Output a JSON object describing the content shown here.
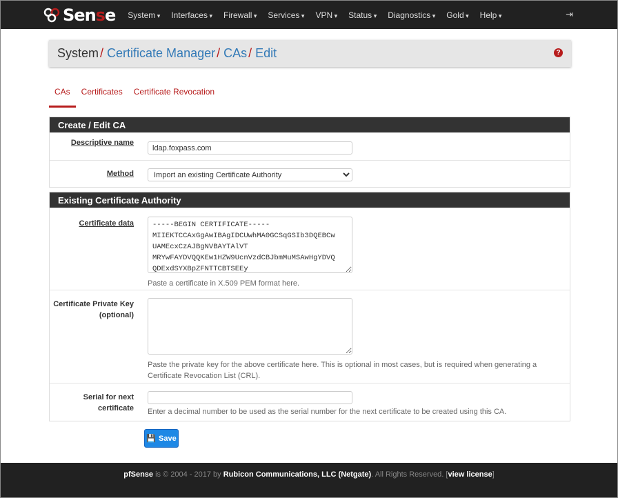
{
  "nav": {
    "logo": "pfSense",
    "logo_pre": "Sen",
    "logo_s": "s",
    "logo_post": "e",
    "menu": [
      "System",
      "Interfaces",
      "Firewall",
      "Services",
      "VPN",
      "Status",
      "Diagnostics",
      "Gold",
      "Help"
    ]
  },
  "breadcrumb": {
    "root": "System",
    "items": [
      "Certificate Manager",
      "CAs",
      "Edit"
    ]
  },
  "tabs": [
    "CAs",
    "Certificates",
    "Certificate Revocation"
  ],
  "panel1": {
    "title": "Create / Edit CA",
    "descriptive_name_label": "Descriptive name",
    "descriptive_name_value": "ldap.foxpass.com",
    "method_label": "Method",
    "method_value": "Import an existing Certificate Authority"
  },
  "panel2": {
    "title": "Existing Certificate Authority",
    "cert_label": "Certificate data",
    "cert_value": "-----BEGIN CERTIFICATE-----\nMIIEKTCCAxGgAwIBAgIDCUwhMA0GCSqGSIb3DQEBCw\nUAMEcxCzAJBgNVBAYTAlVT\nMRYwFAYDVQQKEw1HZW9UcnVzdCBJbmMuMSAwHgYDVQ\nQDExdSYXBpZFNTTCBTSEEy",
    "cert_hint": "Paste a certificate in X.509 PEM format here.",
    "key_label": "Certificate Private Key (optional)",
    "key_value": "",
    "key_hint": "Paste the private key for the above certificate here. This is optional in most cases, but is required when generating a Certificate Revocation List (CRL).",
    "serial_label": "Serial for next certificate",
    "serial_value": "",
    "serial_hint": "Enter a decimal number to be used as the serial number for the next certificate to be created using this CA."
  },
  "save_label": "Save",
  "footer": {
    "brand": "pfSense",
    "text1": " is © 2004 - 2017 by ",
    "company": "Rubicon Communications, LLC (Netgate)",
    "text2": ". All Rights Reserved. [",
    "license": "view license",
    "text3": "]"
  },
  "colors": {
    "accent": "#b71c1c",
    "link": "#337ab7",
    "nav_bg": "#212121",
    "button": "#1e88e5"
  }
}
